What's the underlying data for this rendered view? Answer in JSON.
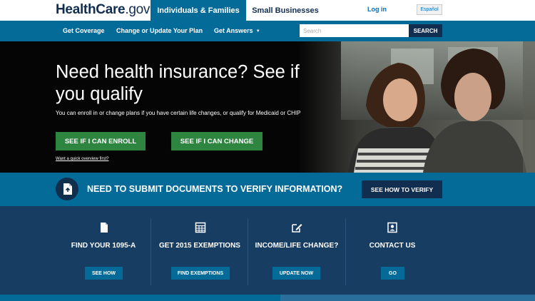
{
  "header": {
    "logo": {
      "main": "HealthCare",
      "dot": ".",
      "tld": "gov"
    },
    "tabs": [
      {
        "label": "Individuals & Families",
        "active": true
      },
      {
        "label": "Small Businesses",
        "active": false
      }
    ],
    "login_label": "Log in",
    "language_label": "Español"
  },
  "nav": {
    "items": [
      {
        "label": "Get Coverage"
      },
      {
        "label": "Change or Update Your Plan"
      },
      {
        "label": "Get Answers"
      }
    ],
    "search": {
      "placeholder": "Search",
      "button_label": "SEARCH"
    }
  },
  "hero": {
    "title": "Need health insurance? See if you qualify",
    "subtitle": "You can enroll in or change plans if you have certain life changes, or qualify for Medicaid or CHIP",
    "buttons": [
      {
        "label": "SEE IF I CAN ENROLL"
      },
      {
        "label": "SEE IF I CAN CHANGE"
      }
    ],
    "quick_link": "Want a quick overview first?"
  },
  "verify_banner": {
    "text": "NEED TO SUBMIT DOCUMENTS TO VERIFY INFORMATION?",
    "button_label": "SEE HOW TO VERIFY"
  },
  "features": [
    {
      "icon": "document-icon",
      "title": "FIND YOUR 1095-A",
      "button_label": "SEE HOW"
    },
    {
      "icon": "calculator-icon",
      "title": "GET 2015 EXEMPTIONS",
      "button_label": "FIND EXEMPTIONS"
    },
    {
      "icon": "edit-icon",
      "title": "INCOME/LIFE CHANGE?",
      "button_label": "UPDATE NOW"
    },
    {
      "icon": "contact-card-icon",
      "title": "CONTACT US",
      "button_label": "GO"
    }
  ],
  "colors": {
    "brand_navy": "#112e51",
    "primary_blue": "#046b99",
    "action_green": "#2e8540",
    "feature_bg": "#183d63"
  }
}
